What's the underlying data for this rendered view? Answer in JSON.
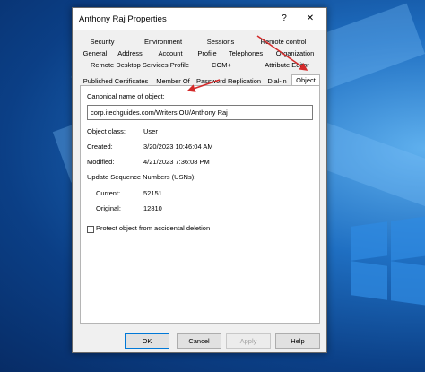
{
  "window": {
    "title": "Anthony Raj Properties",
    "help_glyph": "?",
    "close_glyph": "✕"
  },
  "tabs": {
    "row1": [
      "Security",
      "Environment",
      "Sessions",
      "Remote control"
    ],
    "row2": [
      "General",
      "Address",
      "Account",
      "Profile",
      "Telephones",
      "Organization"
    ],
    "row3": [
      "Remote Desktop Services Profile",
      "COM+",
      "Attribute Editor"
    ],
    "row4": [
      "Published Certificates",
      "Member Of",
      "Password Replication",
      "Dial-in",
      "Object"
    ],
    "active": "Object"
  },
  "object": {
    "canonical_label": "Canonical name of object:",
    "canonical_value": "corp.itechguides.com/Writers OU/Anthony Raj",
    "class_label": "Object class:",
    "class_value": "User",
    "created_label": "Created:",
    "created_value": "3/20/2023 10:46:04 AM",
    "modified_label": "Modified:",
    "modified_value": "4/21/2023 7:36:08 PM",
    "usn_label": "Update Sequence Numbers (USNs):",
    "current_label": "Current:",
    "current_value": "52151",
    "original_label": "Original:",
    "original_value": "12810",
    "protect_label": "Protect object from accidental deletion",
    "protect_checked": false
  },
  "buttons": {
    "ok": "OK",
    "cancel": "Cancel",
    "apply": "Apply",
    "help": "Help"
  },
  "colors": {
    "annotation_arrow": "#d42a2a",
    "accent": "#0078d7"
  }
}
